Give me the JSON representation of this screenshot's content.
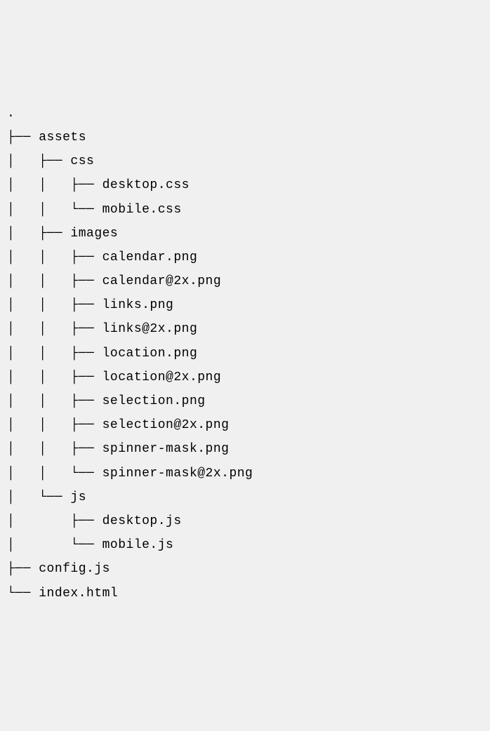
{
  "lines": [
    {
      "prefix": ".",
      "name": ""
    },
    {
      "prefix": "├── ",
      "name": "assets"
    },
    {
      "prefix": "│   ├── ",
      "name": "css"
    },
    {
      "prefix": "│   │   ├── ",
      "name": "desktop.css"
    },
    {
      "prefix": "│   │   └── ",
      "name": "mobile.css"
    },
    {
      "prefix": "│   ├── ",
      "name": "images"
    },
    {
      "prefix": "│   │   ├── ",
      "name": "calendar.png"
    },
    {
      "prefix": "│   │   ├── ",
      "name": "calendar@2x.png"
    },
    {
      "prefix": "│   │   ├── ",
      "name": "links.png"
    },
    {
      "prefix": "│   │   ├── ",
      "name": "links@2x.png"
    },
    {
      "prefix": "│   │   ├── ",
      "name": "location.png"
    },
    {
      "prefix": "│   │   ├── ",
      "name": "location@2x.png"
    },
    {
      "prefix": "│   │   ├── ",
      "name": "selection.png"
    },
    {
      "prefix": "│   │   ├── ",
      "name": "selection@2x.png"
    },
    {
      "prefix": "│   │   ├── ",
      "name": "spinner-mask.png"
    },
    {
      "prefix": "│   │   └── ",
      "name": "spinner-mask@2x.png"
    },
    {
      "prefix": "│   └── ",
      "name": "js"
    },
    {
      "prefix": "│       ├── ",
      "name": "desktop.js"
    },
    {
      "prefix": "│       └── ",
      "name": "mobile.js"
    },
    {
      "prefix": "├── ",
      "name": "config.js"
    },
    {
      "prefix": "└── ",
      "name": "index.html"
    }
  ]
}
